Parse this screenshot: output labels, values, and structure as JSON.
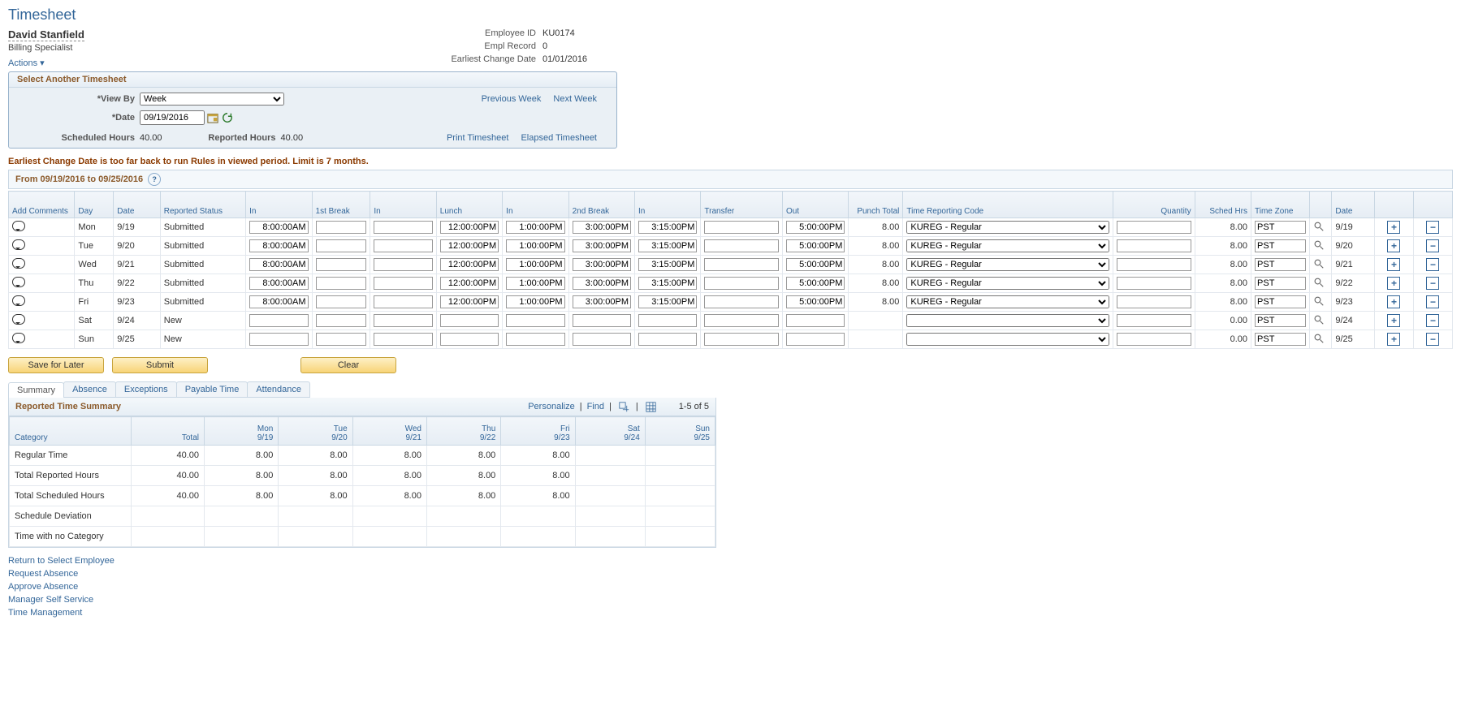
{
  "page_title": "Timesheet",
  "employee": {
    "name": "David Stanfield",
    "title": "Billing Specialist",
    "id_label": "Employee ID",
    "id": "KU0174",
    "record_label": "Empl Record",
    "record": "0",
    "earliest_label": "Earliest Change Date",
    "earliest": "01/01/2016"
  },
  "actions_label": "Actions",
  "select_panel": {
    "title": "Select Another Timesheet",
    "view_by_label": "*View By",
    "view_by_value": "Week",
    "date_label": "*Date",
    "date_value": "09/19/2016",
    "prev_week": "Previous Week",
    "next_week": "Next Week",
    "sched_label": "Scheduled Hours",
    "sched_value": "40.00",
    "rep_label": "Reported Hours",
    "rep_value": "40.00",
    "print_link": "Print Timesheet",
    "elapsed_link": "Elapsed Timesheet"
  },
  "warning": "Earliest Change Date is too far back to run Rules in viewed period. Limit is 7 months.",
  "range_label": "From 09/19/2016 to 09/25/2016",
  "grid": {
    "headers": {
      "add_comments": "Add Comments",
      "day": "Day",
      "date": "Date",
      "status": "Reported Status",
      "in1": "In",
      "brk1": "1st Break",
      "in2": "In",
      "lunch": "Lunch",
      "in3": "In",
      "brk2": "2nd Break",
      "in4": "In",
      "transfer": "Transfer",
      "out": "Out",
      "punch_total": "Punch Total",
      "trc": "Time Reporting Code",
      "qty": "Quantity",
      "sched": "Sched Hrs",
      "tz": "Time Zone",
      "date2": "Date"
    },
    "rows": [
      {
        "day": "Mon",
        "date": "9/19",
        "status": "Submitted",
        "in1": "8:00:00AM",
        "brk1": "",
        "in2": "",
        "lunch": "12:00:00PM",
        "in3": "1:00:00PM",
        "brk2": "3:00:00PM",
        "in4": "3:15:00PM",
        "transfer": "",
        "out": "5:00:00PM",
        "punch": "8.00",
        "trc": "KUREG - Regular",
        "qty": "",
        "sched": "8.00",
        "tz": "PST",
        "date2": "9/19"
      },
      {
        "day": "Tue",
        "date": "9/20",
        "status": "Submitted",
        "in1": "8:00:00AM",
        "brk1": "",
        "in2": "",
        "lunch": "12:00:00PM",
        "in3": "1:00:00PM",
        "brk2": "3:00:00PM",
        "in4": "3:15:00PM",
        "transfer": "",
        "out": "5:00:00PM",
        "punch": "8.00",
        "trc": "KUREG - Regular",
        "qty": "",
        "sched": "8.00",
        "tz": "PST",
        "date2": "9/20"
      },
      {
        "day": "Wed",
        "date": "9/21",
        "status": "Submitted",
        "in1": "8:00:00AM",
        "brk1": "",
        "in2": "",
        "lunch": "12:00:00PM",
        "in3": "1:00:00PM",
        "brk2": "3:00:00PM",
        "in4": "3:15:00PM",
        "transfer": "",
        "out": "5:00:00PM",
        "punch": "8.00",
        "trc": "KUREG - Regular",
        "qty": "",
        "sched": "8.00",
        "tz": "PST",
        "date2": "9/21"
      },
      {
        "day": "Thu",
        "date": "9/22",
        "status": "Submitted",
        "in1": "8:00:00AM",
        "brk1": "",
        "in2": "",
        "lunch": "12:00:00PM",
        "in3": "1:00:00PM",
        "brk2": "3:00:00PM",
        "in4": "3:15:00PM",
        "transfer": "",
        "out": "5:00:00PM",
        "punch": "8.00",
        "trc": "KUREG - Regular",
        "qty": "",
        "sched": "8.00",
        "tz": "PST",
        "date2": "9/22"
      },
      {
        "day": "Fri",
        "date": "9/23",
        "status": "Submitted",
        "in1": "8:00:00AM",
        "brk1": "",
        "in2": "",
        "lunch": "12:00:00PM",
        "in3": "1:00:00PM",
        "brk2": "3:00:00PM",
        "in4": "3:15:00PM",
        "transfer": "",
        "out": "5:00:00PM",
        "punch": "8.00",
        "trc": "KUREG - Regular",
        "qty": "",
        "sched": "8.00",
        "tz": "PST",
        "date2": "9/23"
      },
      {
        "day": "Sat",
        "date": "9/24",
        "status": "New",
        "in1": "",
        "brk1": "",
        "in2": "",
        "lunch": "",
        "in3": "",
        "brk2": "",
        "in4": "",
        "transfer": "",
        "out": "",
        "punch": "",
        "trc": "",
        "qty": "",
        "sched": "0.00",
        "tz": "PST",
        "date2": "9/24"
      },
      {
        "day": "Sun",
        "date": "9/25",
        "status": "New",
        "in1": "",
        "brk1": "",
        "in2": "",
        "lunch": "",
        "in3": "",
        "brk2": "",
        "in4": "",
        "transfer": "",
        "out": "",
        "punch": "",
        "trc": "",
        "qty": "",
        "sched": "0.00",
        "tz": "PST",
        "date2": "9/25"
      }
    ]
  },
  "buttons": {
    "save": "Save for Later",
    "submit": "Submit",
    "clear": "Clear"
  },
  "tabs": [
    "Summary",
    "Absence",
    "Exceptions",
    "Payable Time",
    "Attendance"
  ],
  "active_tab": 0,
  "summary": {
    "title": "Reported Time Summary",
    "toolbar": {
      "personalize": "Personalize",
      "find": "Find",
      "count": "1-5 of 5"
    },
    "headers": {
      "category": "Category",
      "total": "Total",
      "d0": {
        "top": "Mon",
        "bot": "9/19"
      },
      "d1": {
        "top": "Tue",
        "bot": "9/20"
      },
      "d2": {
        "top": "Wed",
        "bot": "9/21"
      },
      "d3": {
        "top": "Thu",
        "bot": "9/22"
      },
      "d4": {
        "top": "Fri",
        "bot": "9/23"
      },
      "d5": {
        "top": "Sat",
        "bot": "9/24"
      },
      "d6": {
        "top": "Sun",
        "bot": "9/25"
      }
    },
    "rows": [
      {
        "cat": "Regular Time",
        "total": "40.00",
        "v": [
          "8.00",
          "8.00",
          "8.00",
          "8.00",
          "8.00",
          "",
          ""
        ]
      },
      {
        "cat": "Total Reported Hours",
        "total": "40.00",
        "v": [
          "8.00",
          "8.00",
          "8.00",
          "8.00",
          "8.00",
          "",
          ""
        ]
      },
      {
        "cat": "Total Scheduled Hours",
        "total": "40.00",
        "v": [
          "8.00",
          "8.00",
          "8.00",
          "8.00",
          "8.00",
          "",
          ""
        ]
      },
      {
        "cat": "Schedule Deviation",
        "total": "",
        "v": [
          "",
          "",
          "",
          "",
          "",
          "",
          ""
        ]
      },
      {
        "cat": "Time with no Category",
        "total": "",
        "v": [
          "",
          "",
          "",
          "",
          "",
          "",
          ""
        ]
      }
    ]
  },
  "bottom_links": [
    "Return to Select Employee",
    "Request Absence",
    "Approve Absence",
    "Manager Self Service",
    "Time Management"
  ]
}
